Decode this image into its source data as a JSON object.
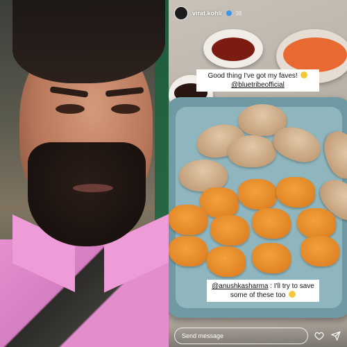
{
  "story": {
    "username": "virat.kohli",
    "time": "38",
    "caption_top": {
      "line1": "Good thing I've got my faves!",
      "line2_mention": "@bluetribeofficial"
    },
    "caption_bottom": {
      "mention": "@anushkasharma",
      "text": " : I'll try to save some of these too"
    },
    "reply_placeholder": "Send message"
  },
  "icons": {
    "verified": "verified-badge-icon",
    "heart": "heart-icon",
    "send": "send-icon",
    "emoji_sunglasses": "sunglasses-emoji-icon",
    "emoji_grin": "grin-emoji-icon"
  }
}
